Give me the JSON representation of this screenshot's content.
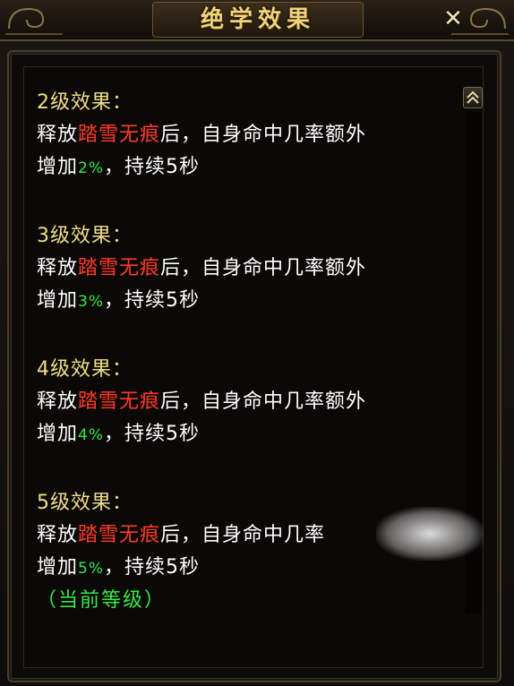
{
  "window": {
    "title": "绝学效果",
    "close_label": "✕"
  },
  "effects": [
    {
      "level_label": "2级效果：",
      "line1_prefix": "释放",
      "skill": "踏雪无痕",
      "line1_suffix": "后，自身命中几率额外",
      "line2_prefix": "增加",
      "percent": "2%",
      "line2_suffix": "，持续5秒"
    },
    {
      "level_label": "3级效果：",
      "line1_prefix": "释放",
      "skill": "踏雪无痕",
      "line1_suffix": "后，自身命中几率额外",
      "line2_prefix": "增加",
      "percent": "3%",
      "line2_suffix": "，持续5秒"
    },
    {
      "level_label": "4级效果：",
      "line1_prefix": "释放",
      "skill": "踏雪无痕",
      "line1_suffix": "后，自身命中几率额外",
      "line2_prefix": "增加",
      "percent": "4%",
      "line2_suffix": "，持续5秒"
    },
    {
      "level_label": "5级效果：",
      "line1_prefix": "释放",
      "skill": "踏雪无痕",
      "line1_suffix": "后，自身命中几率",
      "line2_prefix": "增加",
      "percent": "5%",
      "line2_suffix": "，持续5秒"
    }
  ],
  "current_level_label": "（当前等级）",
  "icons": {
    "close": "close-icon",
    "scroll_up": "double-chevron-up-icon"
  },
  "colors": {
    "title": "#f2d27a",
    "level_heading": "#f0dc88",
    "skill_name": "#ff3a2a",
    "percent": "#35e845",
    "body_text": "#ffffff"
  }
}
